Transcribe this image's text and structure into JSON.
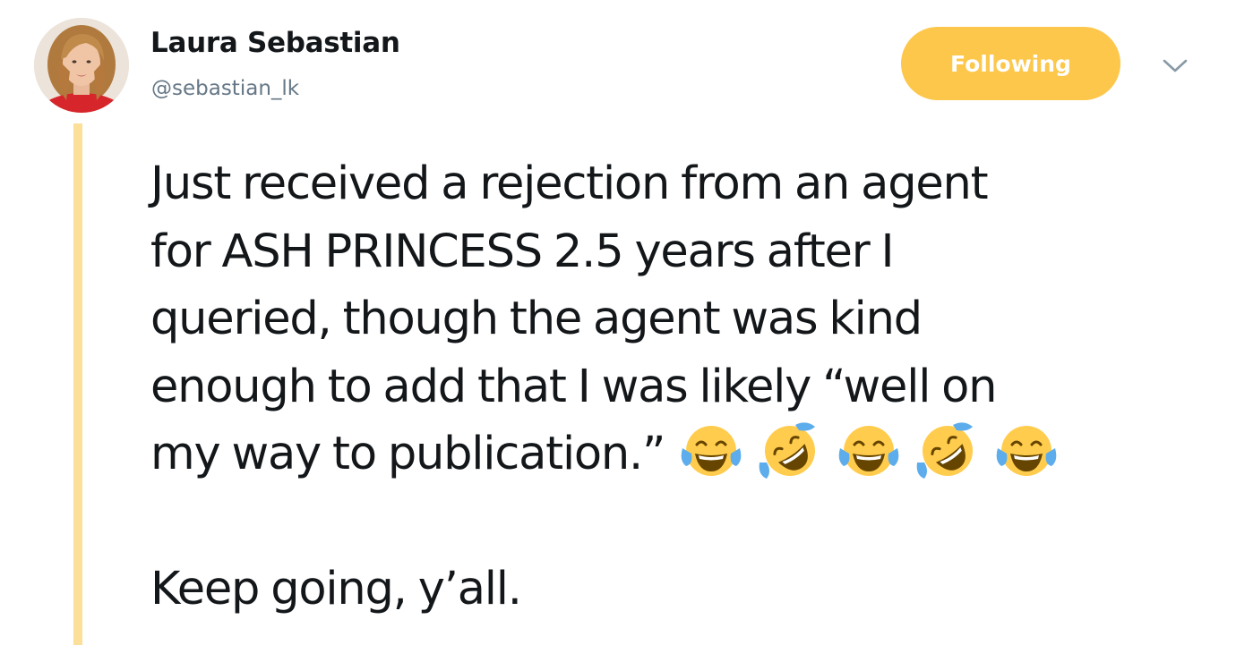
{
  "user": {
    "display_name": "Laura Sebastian",
    "handle": "@sebastian_lk"
  },
  "follow_button": {
    "label": "Following"
  },
  "tweet": {
    "lines": [
      "Just received a rejection from an agent",
      "for ASH PRINCESS 2.5 years after I",
      "queried, though the agent was kind",
      "enough to add that I was likely “well on",
      "my way to publication.”"
    ],
    "emojis": [
      "face-with-tears-of-joy",
      "rolling-on-the-floor-laughing",
      "face-with-tears-of-joy",
      "rolling-on-the-floor-laughing",
      "face-with-tears-of-joy"
    ],
    "closing_line": "Keep going, y’all."
  },
  "colors": {
    "accent": "#fcc74a",
    "thread_line": "#fcdf99",
    "handle": "#657786",
    "text": "#14171a"
  },
  "icons": {
    "menu": "chevron-down-icon"
  }
}
